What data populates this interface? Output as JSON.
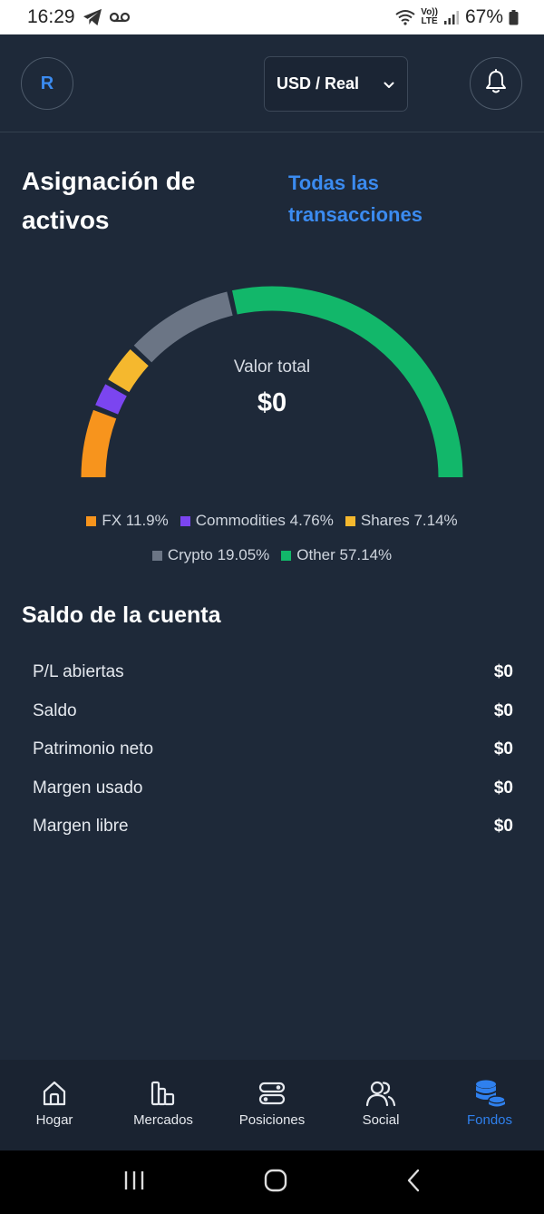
{
  "status_bar": {
    "time": "16:29",
    "volte": [
      "Vo))",
      "LTE"
    ],
    "battery": "67%"
  },
  "header": {
    "avatar_initial": "R",
    "account_selector": "USD / Real"
  },
  "allocation": {
    "title": "Asignación de activos",
    "all_transactions_link": "Todas las transacciones",
    "total_label": "Valor total",
    "total_value": "$0"
  },
  "chart_data": {
    "type": "pie",
    "variant": "semicircle-gauge",
    "segments": [
      {
        "name": "FX",
        "value": 11.9,
        "label": "FX 11.9%",
        "color": "#f7941d"
      },
      {
        "name": "Commodities",
        "value": 4.76,
        "label": "Commodities 4.76%",
        "color": "#7b45f0"
      },
      {
        "name": "Shares",
        "value": 7.14,
        "label": "Shares 7.14%",
        "color": "#f5b82e"
      },
      {
        "name": "Crypto",
        "value": 19.05,
        "label": "Crypto 19.05%",
        "color": "#6b7585"
      },
      {
        "name": "Other",
        "value": 57.14,
        "label": "Other 57.14%",
        "color": "#12b76a"
      }
    ],
    "legend_placement": "bottom"
  },
  "balance": {
    "title": "Saldo de la cuenta",
    "rows": [
      {
        "label": "P/L abiertas",
        "value": "$0"
      },
      {
        "label": "Saldo",
        "value": "$0"
      },
      {
        "label": "Patrimonio neto",
        "value": "$0"
      },
      {
        "label": "Margen usado",
        "value": "$0"
      },
      {
        "label": "Margen libre",
        "value": "$0"
      }
    ]
  },
  "bottom_nav": {
    "items": [
      {
        "label": "Hogar",
        "icon": "home-icon"
      },
      {
        "label": "Mercados",
        "icon": "markets-icon"
      },
      {
        "label": "Posiciones",
        "icon": "positions-icon"
      },
      {
        "label": "Social",
        "icon": "social-icon"
      },
      {
        "label": "Fondos",
        "icon": "funds-icon",
        "active": true
      }
    ]
  },
  "colors": {
    "background": "#1e2939",
    "accent": "#3b8bf0",
    "active_nav": "#2f80ed"
  }
}
